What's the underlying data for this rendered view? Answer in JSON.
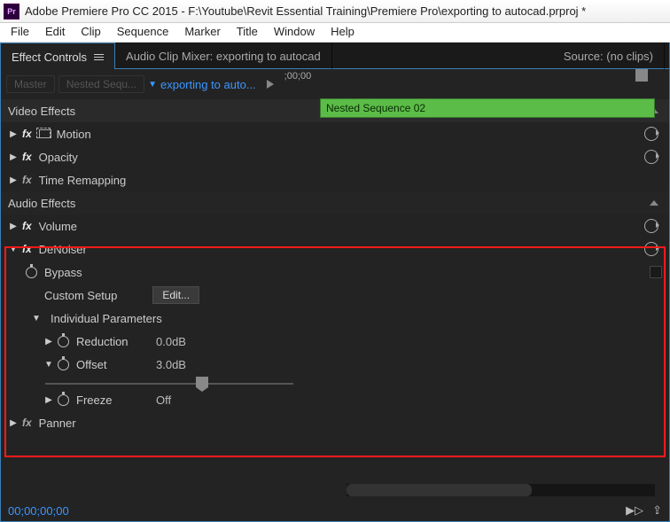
{
  "app_icon_text": "Pr",
  "window_title": "Adobe Premiere Pro CC 2015 - F:\\Youtube\\Revit Essential Training\\Premiere Pro\\exporting to autocad.prproj *",
  "menu": [
    "File",
    "Edit",
    "Clip",
    "Sequence",
    "Marker",
    "Title",
    "Window",
    "Help"
  ],
  "tabs": {
    "effect_controls": "Effect Controls",
    "audio_mixer": "Audio Clip Mixer: exporting to autocad",
    "source": "Source: (no clips)"
  },
  "breadcrumb": {
    "master": "Master",
    "nested": "Nested Sequ...",
    "clip": "exporting to auto..."
  },
  "timeline": {
    "tick": ";00;00"
  },
  "clip_name": "Nested Sequence 02",
  "sections": {
    "video_effects": "Video Effects",
    "audio_effects": "Audio Effects"
  },
  "video_rows": {
    "motion": "Motion",
    "opacity": "Opacity",
    "time_remap": "Time Remapping"
  },
  "audio_rows": {
    "volume": "Volume",
    "denoiser": "DeNoiser",
    "bypass": "Bypass",
    "custom_setup": "Custom Setup",
    "edit_btn": "Edit...",
    "indiv_params": "Individual Parameters",
    "reduction": {
      "label": "Reduction",
      "value": "0.0dB"
    },
    "offset": {
      "label": "Offset",
      "value": "3.0dB"
    },
    "freeze": {
      "label": "Freeze",
      "value": "Off"
    },
    "panner": "Panner"
  },
  "timecode": "00;00;00;00"
}
